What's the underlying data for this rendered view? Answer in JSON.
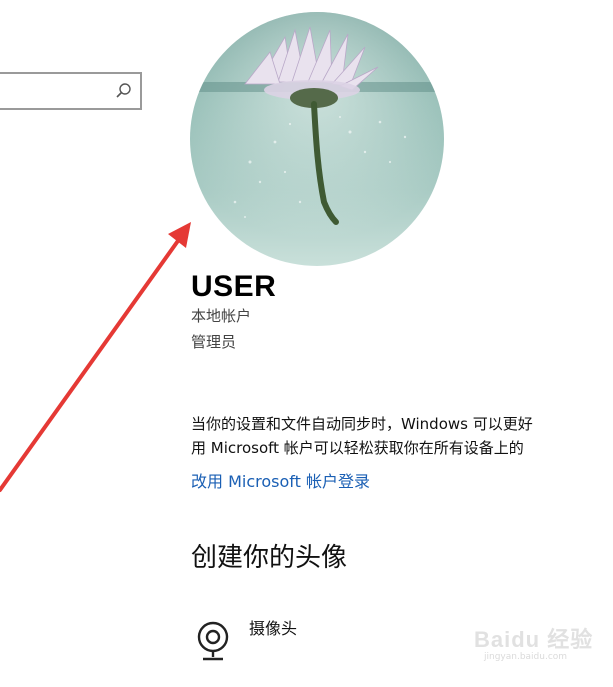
{
  "search": {
    "value": "",
    "icon": "search-icon"
  },
  "profile": {
    "avatar_icon": "user-avatar-flower-photo",
    "name": "USER",
    "account_type": "本地帐户",
    "role": "管理员"
  },
  "sync_info": {
    "line1": "当你的设置和文件自动同步时，Windows 可以更好",
    "line2": "用 Microsoft 帐户可以轻松获取你在所有设备上的"
  },
  "links": {
    "microsoft_signin": "改用 Microsoft 帐户登录"
  },
  "create_avatar": {
    "heading": "创建你的头像",
    "camera_label": "摄像头",
    "camera_icon": "webcam-icon"
  },
  "watermark": {
    "brand": "Baidu 经验",
    "url": "jingyan.baidu.com"
  },
  "colors": {
    "link": "#1a5fb4",
    "arrow": "#e53935"
  }
}
